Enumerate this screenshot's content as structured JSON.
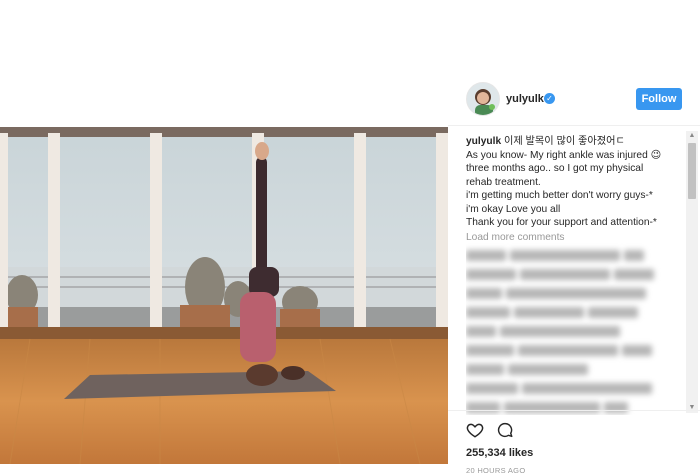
{
  "post": {
    "username": "yulyulk",
    "follow_label": "Follow",
    "caption_username": "yulyulk",
    "caption_lines": [
      "이제 발목이 많이 좋아졌어ㄷ",
      "As you know- My right ankle was injured 😉",
      "three months ago.. so I got my physical",
      "rehab treatment.",
      "i'm getting much better don't worry guys-*",
      "i'm okay Love you all",
      "Thank you for your support and attention-*"
    ],
    "load_more_label": "Load more comments",
    "likes": "255,334 likes",
    "time": "20 HOURS AGO"
  },
  "icons": {
    "verified": "verified-badge-icon",
    "heart": "heart-icon",
    "comment": "comment-icon"
  },
  "colors": {
    "accent": "#3897f0",
    "muted": "#999999",
    "text": "#262626"
  }
}
